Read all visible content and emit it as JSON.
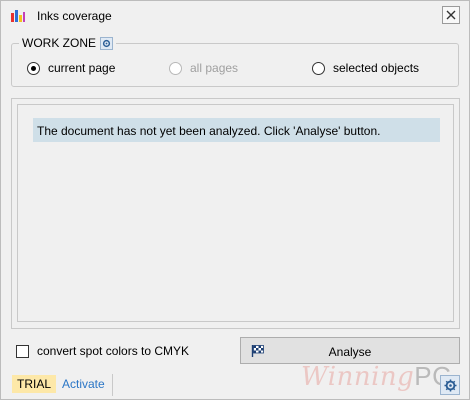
{
  "window": {
    "title": "Inks coverage",
    "app_icon": "ink-bars-icon",
    "close_icon": "close-icon"
  },
  "work_zone": {
    "label": "WORK ZONE",
    "settings_icon": "gear-icon",
    "options": [
      {
        "label": "current page",
        "selected": true,
        "enabled": true
      },
      {
        "label": "all pages",
        "selected": false,
        "enabled": false
      },
      {
        "label": "selected objects",
        "selected": false,
        "enabled": true
      }
    ]
  },
  "results": {
    "message": "The document has not yet been analyzed. Click 'Analyse' button."
  },
  "options": {
    "convert_spot_label": "convert spot colors to CMYK",
    "convert_spot_checked": false
  },
  "actions": {
    "analyse_label": "Analyse",
    "analyse_icon": "checkered-flag-icon"
  },
  "status": {
    "trial_label": "TRIAL",
    "activate_label": "Activate",
    "settings_icon": "gear-icon"
  },
  "watermark": {
    "text": "Winning",
    "suffix": "PC"
  },
  "colors": {
    "message_bg": "#cfdfe8",
    "trial_bg": "#fde8a8",
    "link": "#2a76c6"
  }
}
